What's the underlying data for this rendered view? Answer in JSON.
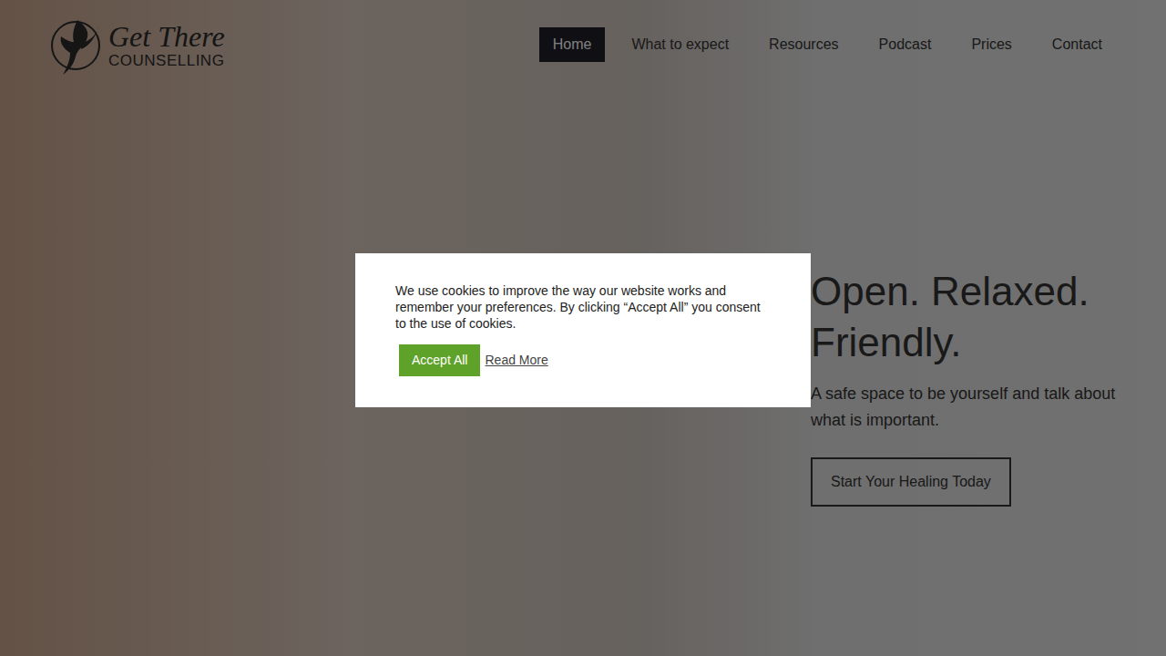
{
  "logo": {
    "script": "Get There",
    "subtitle": "COUNSELLING"
  },
  "nav": [
    {
      "label": "Home",
      "selected": true
    },
    {
      "label": "What to expect",
      "selected": false
    },
    {
      "label": "Resources",
      "selected": false
    },
    {
      "label": "Podcast",
      "selected": false
    },
    {
      "label": "Prices",
      "selected": false
    },
    {
      "label": "Contact",
      "selected": false
    }
  ],
  "hero": {
    "heading": "Open. Relaxed. Friendly.",
    "subtitle": "A safe space to be yourself and talk about what is important.",
    "button": "Start Your Healing Today"
  },
  "cookie_dialog": {
    "message": "We use cookies to improve the way our website works and remember your preferences. By clicking “Accept All” you consent to the use of cookies.",
    "accept_button": "Accept All",
    "read_more_link": "Read More"
  }
}
